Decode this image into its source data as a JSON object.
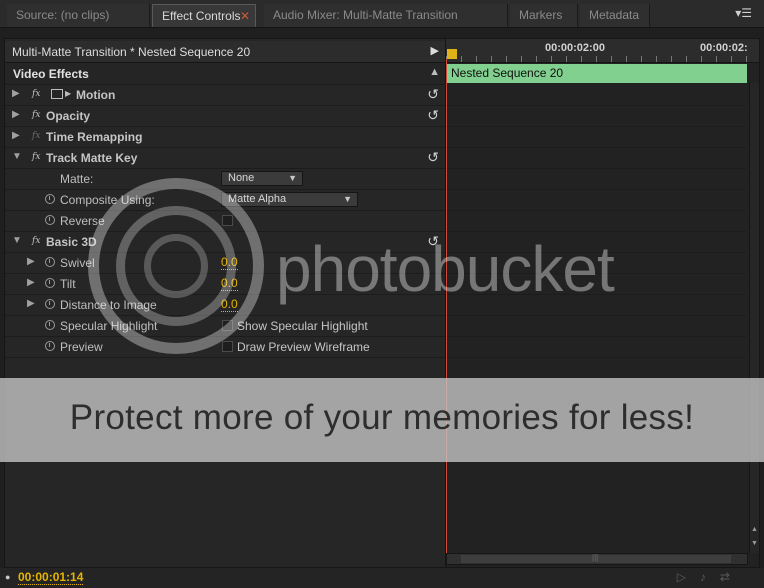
{
  "tabs": [
    {
      "label": "Source: (no clips)",
      "active": false
    },
    {
      "label": "Effect Controls",
      "active": true
    },
    {
      "label": "Audio Mixer: Multi-Matte Transition",
      "active": false
    },
    {
      "label": "Markers",
      "active": false
    },
    {
      "label": "Metadata",
      "active": false
    }
  ],
  "panel_menu_icon": "panel-menu-icon",
  "clip_header": {
    "title": "Multi-Matte Transition * Nested Sequence 20"
  },
  "video_effects": {
    "label": "Video Effects"
  },
  "effects": {
    "motion": {
      "label": "Motion"
    },
    "opacity": {
      "label": "Opacity"
    },
    "time_remapping": {
      "label": "Time Remapping"
    },
    "track_matte_key": {
      "label": "Track Matte Key",
      "matte_label": "Matte:",
      "matte_value": "None",
      "composite_label": "Composite Using:",
      "composite_value": "Matte Alpha",
      "reverse_label": "Reverse"
    },
    "basic_3d": {
      "label": "Basic 3D",
      "swivel_label": "Swivel",
      "swivel_value": "0.0",
      "tilt_label": "Tilt",
      "tilt_value": "0.0",
      "distance_label": "Distance to Image",
      "distance_value": "0.0",
      "specular_label": "Specular Highlight",
      "specular_cb_label": "Show Specular Highlight",
      "preview_label": "Preview",
      "preview_cb_label": "Draw Preview Wireframe"
    }
  },
  "timeline": {
    "ruler_tc_1": "00:00:02:00",
    "ruler_tc_2": "00:00:02:",
    "clip_label": "Nested Sequence 20",
    "clip_color": "#82d08f",
    "playhead_color": "#d24a35"
  },
  "bottom": {
    "timecode": "00:00:01:14"
  },
  "watermark": {
    "brand": "photobucket",
    "banner": "Protect more of your memories for less!"
  }
}
